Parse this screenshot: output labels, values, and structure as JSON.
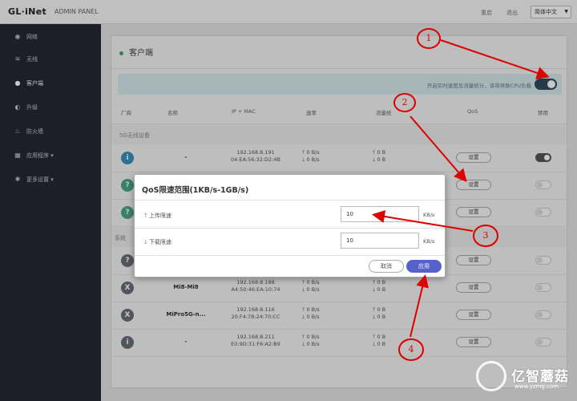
{
  "topbar": {
    "logo": "GL·iNet",
    "admin_label": "ADMIN PANEL",
    "link_1": "重启",
    "link_2": "退出",
    "language": "简体中文"
  },
  "sidebar": {
    "items": [
      {
        "label": "网络",
        "icon": "globe-icon"
      },
      {
        "label": "无线",
        "icon": "wifi-icon"
      },
      {
        "label": "客户端",
        "icon": "user-icon",
        "active": true
      },
      {
        "label": "升级",
        "icon": "upgrade-icon"
      },
      {
        "label": "防火墙",
        "icon": "firewall-icon"
      },
      {
        "label": "应用程序",
        "icon": "apps-icon"
      },
      {
        "label": "更多设置",
        "icon": "gear-icon"
      }
    ]
  },
  "panel": {
    "title": "客户端",
    "notice": "开启实时速度及流量统计，该将导致CPU负载",
    "columns": [
      "厂商",
      "名称",
      "IP + MAC",
      "速率",
      "流量统",
      "QoS",
      "禁用"
    ]
  },
  "groups": {
    "wireless_5g": "5G无线设备",
    "other": "系统"
  },
  "rows": [
    {
      "avatar": "i",
      "name": "-",
      "ip": "192.168.8.191",
      "mac": "04:EA:56:32:D2:4B",
      "rate_up": "0 B/s",
      "rate_down": "0 B/s",
      "traffic_up": "0 B",
      "traffic_down": "0 B",
      "qos": "设置",
      "disabled": true
    },
    {
      "avatar": "?",
      "qos": "设置"
    },
    {
      "avatar": "?",
      "qos": "设置"
    },
    {
      "avatar": "?",
      "qos": "设置"
    },
    {
      "avatar": "X",
      "name": "Mi8-Mi8",
      "ip": "192.168.8.188",
      "mac": "A4:50:46:EA:10:74",
      "rate_up": "0 B/s",
      "rate_down": "0 B/s",
      "traffic_up": "0 B",
      "traffic_down": "0 B",
      "qos": "设置"
    },
    {
      "avatar": "X",
      "name": "MiPro5G-n...",
      "ip": "192.168.8.116",
      "mac": "20:F4:78:24:70:CC",
      "rate_up": "0 B/s",
      "rate_down": "0 B/s",
      "traffic_up": "0 B",
      "traffic_down": "0 B",
      "qos": "设置"
    },
    {
      "avatar": "i",
      "name": "-",
      "ip": "192.168.8.211",
      "mac": "E0:9D:31:F6:A2:B9",
      "rate_up": "0 B/s",
      "rate_down": "0 B/s",
      "traffic_up": "0 B",
      "traffic_down": "0 B",
      "qos": "设置"
    }
  ],
  "modal": {
    "title": "QoS限速范围(1KB/s-1GB/s)",
    "upload_label": "上传限速",
    "upload_value": "10",
    "download_label": "下载限速",
    "download_value": "10",
    "unit": "KB/s",
    "cancel": "取消",
    "apply": "应用"
  },
  "annotations": [
    "1",
    "2",
    "3",
    "4"
  ],
  "watermark": {
    "brand": "亿智蘑菇",
    "url": "www.yzmg.com"
  },
  "colors": {
    "sidebar_bg": "#242832",
    "accent_apply": "#5561c9",
    "annotation": "#dd0000",
    "notice_bg": "#d4e8ec"
  }
}
